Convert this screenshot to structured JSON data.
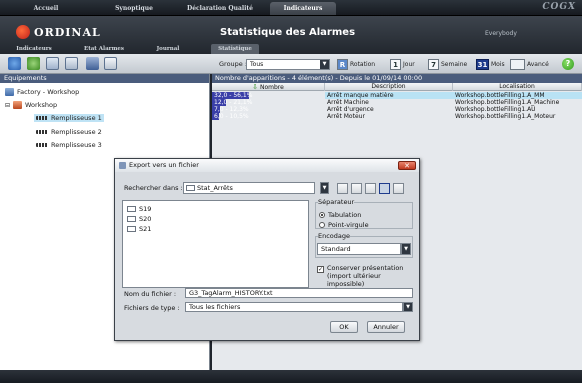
{
  "topnav": {
    "tabs": [
      "Accueil",
      "Synoptique",
      "Déclaration Qualité",
      "Indicateurs"
    ],
    "active": 3,
    "brand": "COGX"
  },
  "header": {
    "logo": "ORDINAL",
    "title": "Statistique des Alarmes",
    "user": "Everybody",
    "subtabs": [
      "Indicateurs",
      "Etat Alarmes",
      "Journal",
      "Statistique"
    ]
  },
  "toolbar": {
    "group_label": "Groupe :",
    "group_value": "Tous",
    "period_buttons": [
      {
        "label": "Rotation",
        "icon_text": "R"
      },
      {
        "label": "Jour",
        "icon_text": "1"
      },
      {
        "label": "Semaine",
        "icon_text": "7"
      },
      {
        "label": "Mois",
        "icon_text": "31"
      },
      {
        "label": "Avancé",
        "icon_text": ""
      }
    ],
    "active_period": 3
  },
  "equipments": {
    "heading": "Equipements",
    "root": "Factory - Workshop",
    "workshop": "Workshop",
    "items": [
      "Remplisseuse 1",
      "Remplisseuse 2",
      "Remplisseuse 3"
    ],
    "selected": 0
  },
  "grid": {
    "heading": "Nombre d'apparitions - 4 élément(s) - Depuis le 01/09/14 00:00",
    "columns": [
      "Nombre",
      "Description",
      "Localisation"
    ],
    "rows": [
      {
        "nombre": "32,0 - 56,1%",
        "pct": 56.1,
        "description": "Arrêt manque matière",
        "localisation": "Workshop.bottleFilling1.A_MM"
      },
      {
        "nombre": "12,0 - 21,1%",
        "pct": 21.1,
        "description": "Arrêt Machine",
        "localisation": "Workshop.bottleFilling1.A_Machine"
      },
      {
        "nombre": "7,0 - 12,3%",
        "pct": 12.3,
        "description": "Arrêt d'urgence",
        "localisation": "Workshop.bottleFilling1.AU"
      },
      {
        "nombre": "6,0 - 10,5%",
        "pct": 10.5,
        "description": "Arrêt Moteur",
        "localisation": "Workshop.bottleFilling1.A_Moteur"
      }
    ]
  },
  "dialog": {
    "title": "Export vers un fichier",
    "look_in_label": "Rechercher dans :",
    "look_in_value": "Stat_Arrêts",
    "files": [
      "S19",
      "S20",
      "S21"
    ],
    "separator": {
      "legend": "Séparateur",
      "options": [
        "Tabulation",
        "Point-virgule"
      ],
      "selected": 0
    },
    "encoding": {
      "legend": "Encodage",
      "value": "Standard"
    },
    "keep_presentation": "Conserver présentation (import ultérieur impossible)",
    "keep_presentation_checked": true,
    "filename_label": "Nom du fichier :",
    "filename_value": "G3_TagAlarm_HISTORY.txt",
    "filetype_label": "Fichiers de type :",
    "filetype_value": "Tous les fichiers",
    "ok": "OK",
    "cancel": "Annuler"
  }
}
